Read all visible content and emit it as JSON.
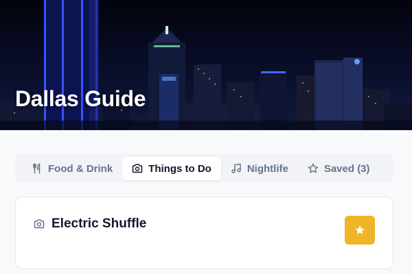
{
  "hero": {
    "title": "Dallas Guide",
    "image": "dallas-skyline-at-night"
  },
  "tabs": [
    {
      "label": "Food & Drink",
      "icon": "utensils-icon",
      "active": false
    },
    {
      "label": "Things to Do",
      "icon": "camera-icon",
      "active": true
    },
    {
      "label": "Nightlife",
      "icon": "music-note-icon",
      "active": false
    },
    {
      "label": "Saved (3)",
      "icon": "star-outline-icon",
      "active": false
    }
  ],
  "place": {
    "name": "Electric Shuffle",
    "icon": "camera-icon",
    "favorite_icon": "star-icon",
    "favorited": true
  },
  "colors": {
    "accent": "#f0b429",
    "hero_bg": "#070a1c",
    "active_tab_bg": "#ffffff",
    "muted_text": "#64748b"
  }
}
